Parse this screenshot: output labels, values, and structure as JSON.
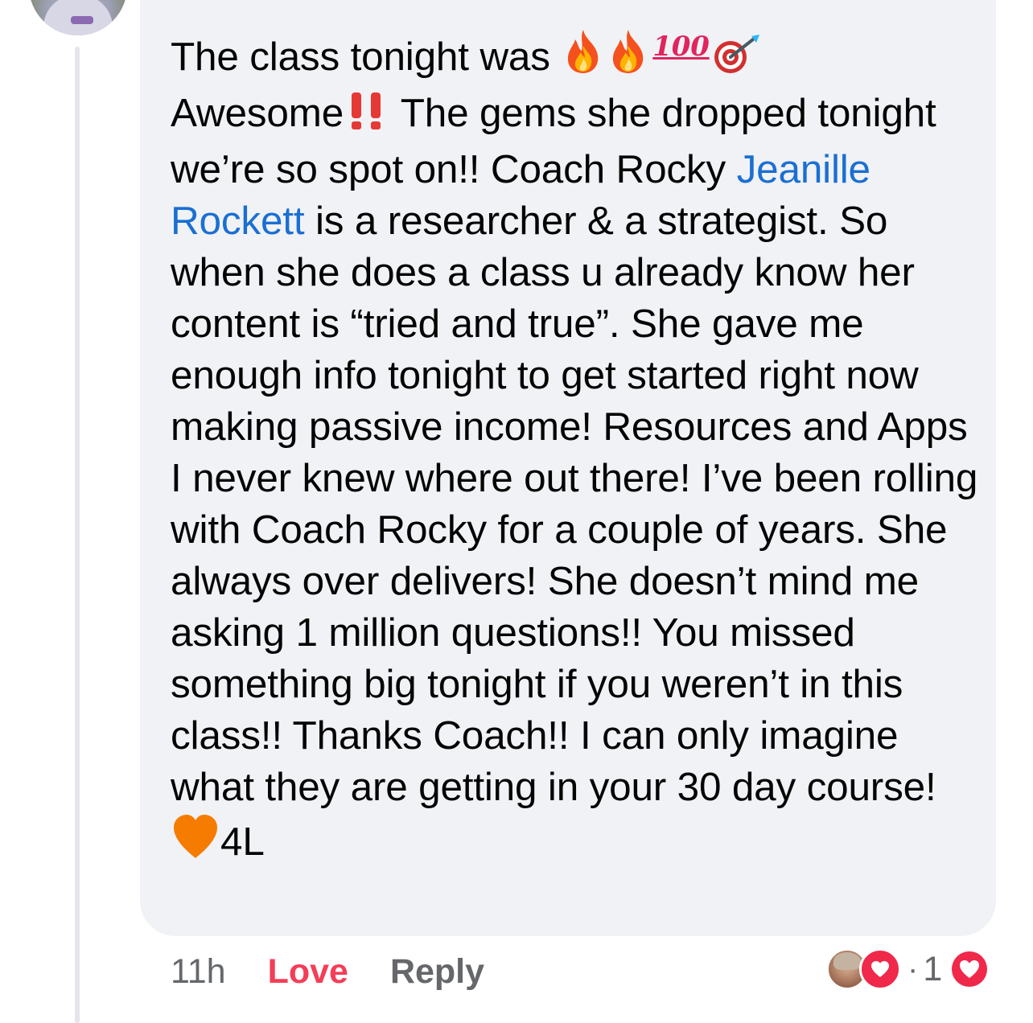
{
  "comment": {
    "line1": "The class tonight was ",
    "line1_hundred": "100",
    "text_a": "Awesome",
    "text_b": " The gems she dropped tonight we’re so spot on!! Coach Rocky ",
    "mention": "Jeanille Rockett",
    "text_c": " is a researcher & a strategist. So when she does a  class u already know her content is “tried and true”. She gave me enough info tonight to get started right now making passive income! Resources and Apps I never knew where out there! I’ve been rolling with Coach Rocky for a couple of years. She always over delivers! She doesn’t mind me asking 1 million questions!! You missed something big tonight if you weren’t in this class!! Thanks Coach!! I can only imagine what they are getting in your 30 day course! ",
    "text_end": "4L"
  },
  "actions": {
    "timestamp": "11h",
    "love_label": "Love",
    "reply_label": "Reply"
  },
  "reactions": {
    "separator": "·",
    "count": "1"
  },
  "colors": {
    "love": "#f33e58",
    "mention": "#1b6fd2",
    "muted": "#65676b",
    "bubble": "#f0f2f5"
  }
}
